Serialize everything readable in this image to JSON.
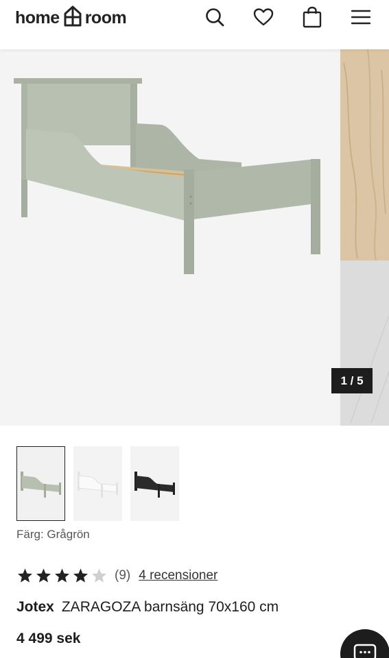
{
  "header": {
    "logo_left": "home",
    "logo_right": "room",
    "icons": [
      "search-icon",
      "heart-icon",
      "bag-icon",
      "menu-icon"
    ]
  },
  "gallery": {
    "counter": "1 / 5",
    "main_image": "sage-green-toddler-bed",
    "thumbnails": [
      {
        "name": "thumbnail-green-bed",
        "color": "#b6bfb0",
        "selected": true
      },
      {
        "name": "thumbnail-white-bed",
        "color": "#f7f7f7",
        "selected": false
      },
      {
        "name": "thumbnail-black-bed",
        "color": "#2b2b2b",
        "selected": false
      }
    ]
  },
  "product": {
    "color_label": "Färg: Grågrön",
    "rating": 4,
    "rating_max": 5,
    "rating_count": "(9)",
    "reviews_link": "4 recensioner",
    "brand": "Jotex",
    "name": "ZARAGOZA barnsäng 70x160 cm",
    "price": "4 499 sek"
  },
  "colors": {
    "text": "#1d1d1d",
    "bed_green": "#b6bfb0",
    "counter_bg": "#1d1d1d",
    "star_filled": "#222222",
    "star_empty": "#cfcfcf"
  }
}
